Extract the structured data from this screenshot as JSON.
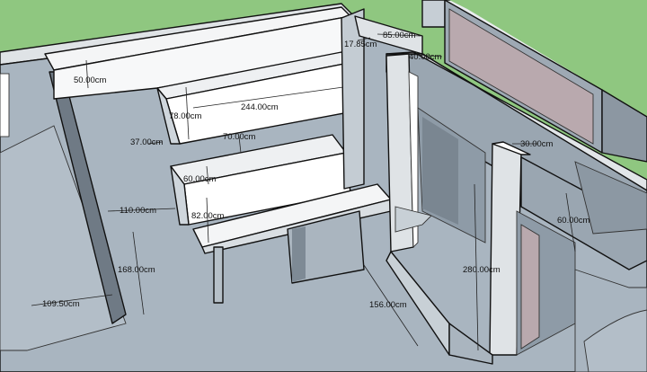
{
  "palette": {
    "grass": "#8fc780",
    "floor": "#a9b5c0",
    "floor_dark": "#8e9ba7",
    "wall_light": "#f4f5f6",
    "wall_mid": "#b8c2cc",
    "wall_dark": "#7f8b96",
    "beam": "#9aa6b1",
    "pink": "#bca8ad",
    "edge": "#111111"
  },
  "dimensions": [
    {
      "id": "d-50",
      "label": "50.00cm"
    },
    {
      "id": "d-78",
      "label": "78.00cm"
    },
    {
      "id": "d-244",
      "label": "244.00cm"
    },
    {
      "id": "d-37",
      "label": "37.00cm"
    },
    {
      "id": "d-70",
      "label": "70.00cm"
    },
    {
      "id": "d-60a",
      "label": "60.00cm"
    },
    {
      "id": "d-82",
      "label": "82.00cm"
    },
    {
      "id": "d-110",
      "label": "110.00cm"
    },
    {
      "id": "d-168",
      "label": "168.00cm"
    },
    {
      "id": "d-1095",
      "label": "109.50cm"
    },
    {
      "id": "d-1785",
      "label": "17.85cm"
    },
    {
      "id": "d-85",
      "label": "85.00cm"
    },
    {
      "id": "d-40",
      "label": "40.00cm"
    },
    {
      "id": "d-30",
      "label": "30.00cm"
    },
    {
      "id": "d-60b",
      "label": "60.00cm"
    },
    {
      "id": "d-280",
      "label": "280.00cm"
    },
    {
      "id": "d-156",
      "label": "156.00cm"
    }
  ]
}
